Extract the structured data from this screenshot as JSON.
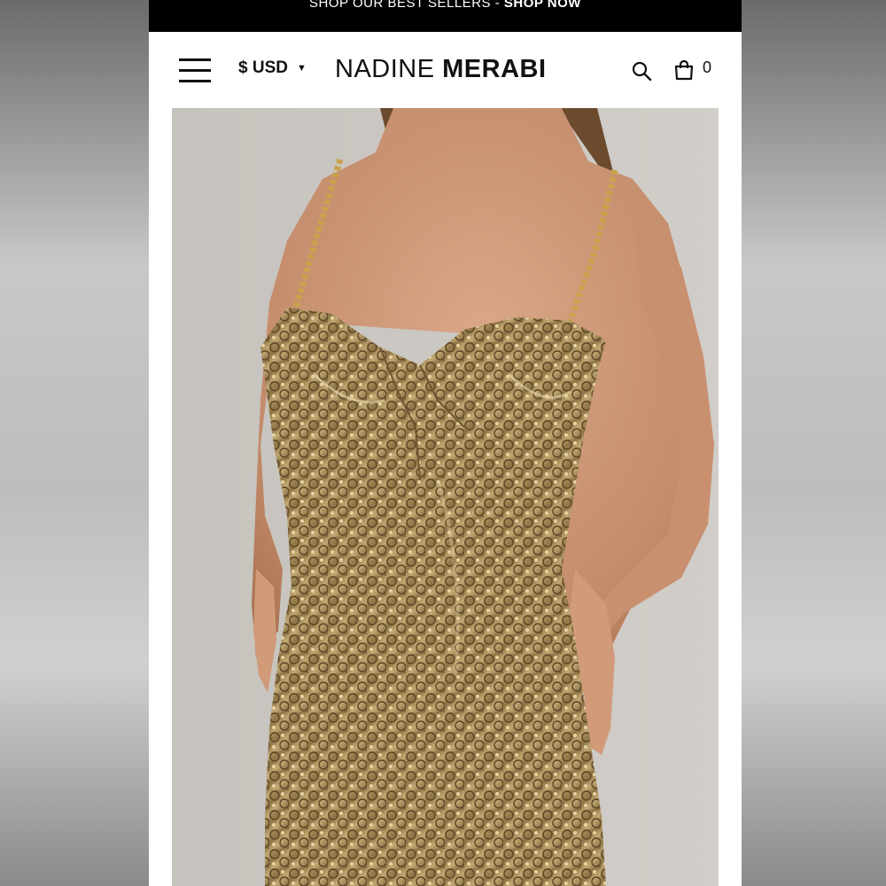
{
  "promo": {
    "text": "SHOP OUR BEST SELLERS - ",
    "cta": "SHOP NOW"
  },
  "header": {
    "currency": "$ USD",
    "brand_light": "NADINE ",
    "brand_bold": "MERABI",
    "cart_count": "0"
  },
  "icons": {
    "menu": "hamburger-menu-icon",
    "currency_caret": "caret-down-icon",
    "search": "search-icon",
    "bag": "shopping-bag-icon"
  },
  "colors": {
    "promo_bar": "#000000",
    "page_background": "#ffffff",
    "hero_background": "#c9c5c0",
    "dress_gold": "#9c8452"
  }
}
